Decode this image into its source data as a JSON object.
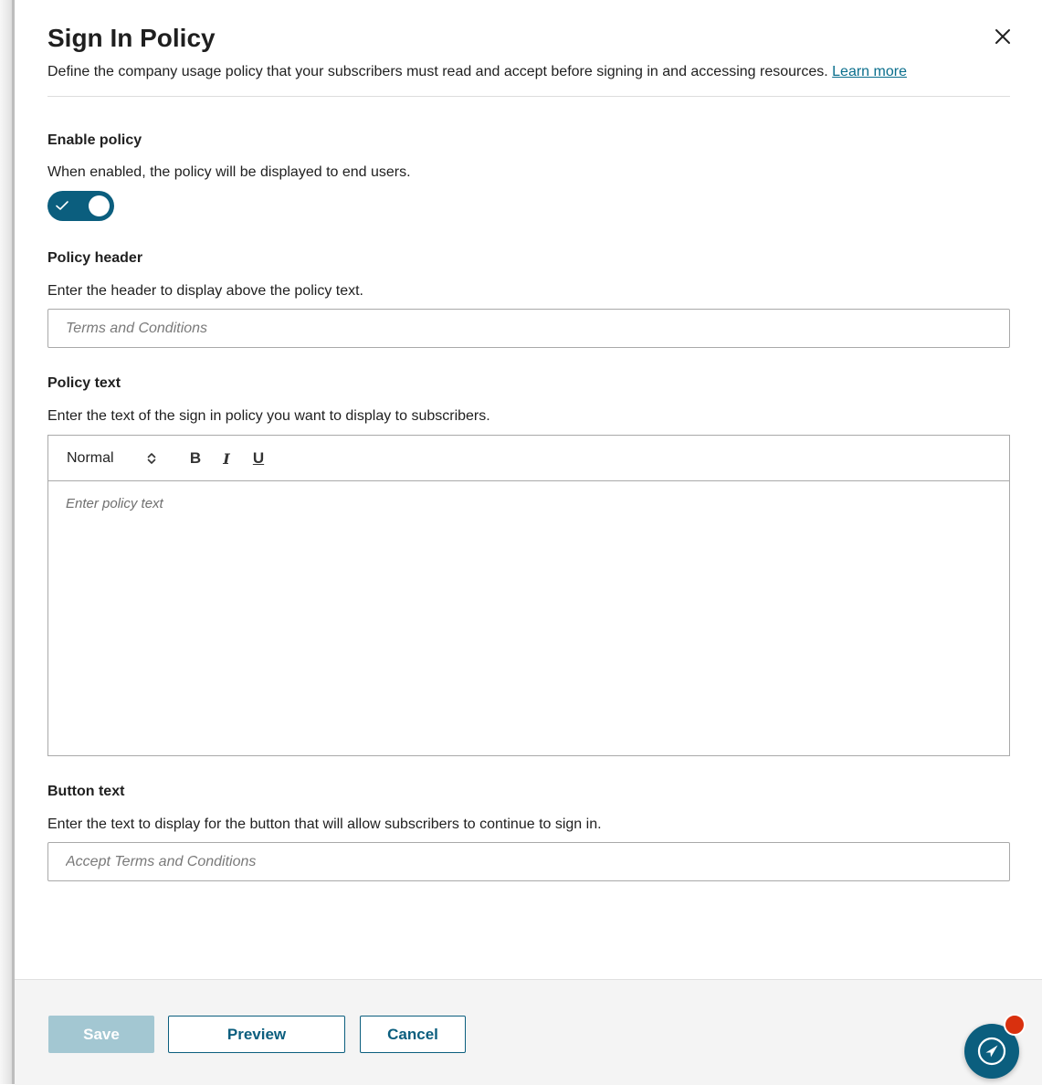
{
  "dialog": {
    "title": "Sign In Policy",
    "description": "Define the company usage policy that your subscribers must read and accept before signing in and accessing resources.",
    "learn_more": "Learn more",
    "close_icon": "close-icon"
  },
  "enable_policy": {
    "label": "Enable policy",
    "help": "When enabled, the policy will be displayed to end users.",
    "enabled": true
  },
  "policy_header": {
    "label": "Policy header",
    "help": "Enter the header to display above the policy text.",
    "placeholder": "Terms and Conditions",
    "value": ""
  },
  "policy_text": {
    "label": "Policy text",
    "help": "Enter the text of the sign in policy you want to display to subscribers.",
    "format_selected": "Normal",
    "toolbar": {
      "bold": "B",
      "italic": "I",
      "underline": "U"
    },
    "placeholder": "Enter policy text"
  },
  "button_text": {
    "label": "Button text",
    "help": "Enter the text to display for the button that will allow subscribers to continue to sign in.",
    "placeholder": "Accept Terms and Conditions",
    "value": ""
  },
  "footer": {
    "save_label": "Save",
    "preview_label": "Preview",
    "cancel_label": "Cancel"
  },
  "colors": {
    "accent": "#0b5e7e",
    "link": "#0a6e8c",
    "save_disabled": "#a3c7d2",
    "badge": "#d9300e"
  }
}
